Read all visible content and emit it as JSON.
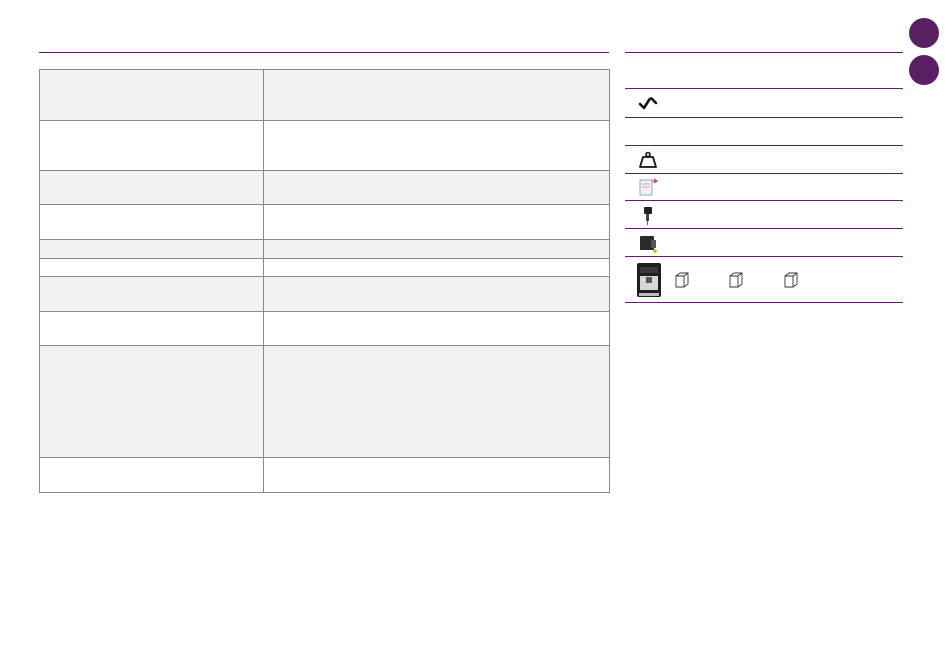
{
  "header": {
    "left_title": "",
    "right_title": ""
  },
  "table": {
    "rows": [
      {
        "label": "",
        "value": ""
      },
      {
        "label": "",
        "value": ""
      },
      {
        "label": "",
        "value": ""
      },
      {
        "label": "",
        "value": ""
      },
      {
        "label": "",
        "value": ""
      },
      {
        "label": "",
        "value": ""
      },
      {
        "label": "",
        "value": ""
      },
      {
        "label": "",
        "value": ""
      },
      {
        "label": "",
        "value": ""
      },
      {
        "label": "",
        "value": ""
      }
    ]
  },
  "sidebar": {
    "items": [
      {
        "icon": "none",
        "label": ""
      },
      {
        "icon": "checkmark-icon",
        "label": ""
      },
      {
        "icon": "none",
        "label": ""
      },
      {
        "icon": "weight-icon",
        "label": ""
      },
      {
        "icon": "water-tank-icon",
        "label": ""
      },
      {
        "icon": "milk-spout-icon",
        "label": ""
      },
      {
        "icon": "bean-container-icon",
        "label": ""
      },
      {
        "icon": "coffee-machine-icon",
        "label": ""
      }
    ]
  },
  "colors": {
    "accent": "#5b1f63",
    "row_shade": "#f2f2f2",
    "border": "#8a8a8a"
  }
}
